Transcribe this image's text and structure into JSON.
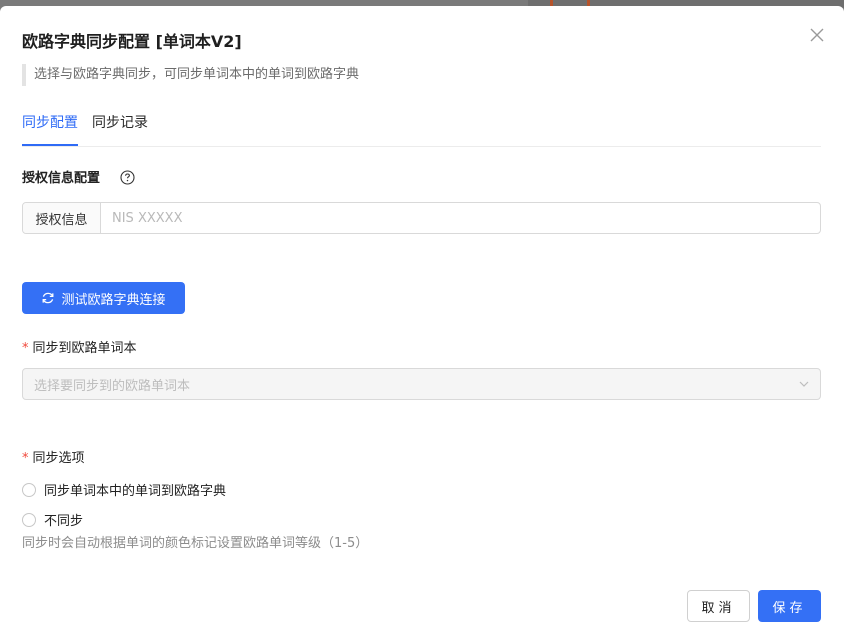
{
  "dialog": {
    "title": "欧路字典同步配置 [单词本V2]",
    "description": "选择与欧路字典同步，可同步单词本中的单词到欧路字典"
  },
  "tabs": [
    {
      "label": "同步配置",
      "active": true
    },
    {
      "label": "同步记录",
      "active": false
    }
  ],
  "auth": {
    "section_label": "授权信息配置",
    "addon_label": "授权信息",
    "placeholder": "NIS XXXXX",
    "value": ""
  },
  "test_button": {
    "label": "测试欧路字典连接"
  },
  "wordbook": {
    "label": "同步到欧路单词本",
    "required_mark": "*",
    "placeholder": "选择要同步到的欧路单词本"
  },
  "sync_options": {
    "label": "同步选项",
    "required_mark": "*",
    "options": [
      {
        "label": "同步单词本中的单词到欧路字典",
        "selected": false
      },
      {
        "label": "不同步",
        "selected": false
      }
    ],
    "hint": "同步时会自动根据单词的颜色标记设置欧路单词等级（1-5）"
  },
  "footer": {
    "cancel_label": "取消",
    "save_label": "保存"
  },
  "colors": {
    "primary": "#3470f5",
    "required": "#f0473a"
  }
}
